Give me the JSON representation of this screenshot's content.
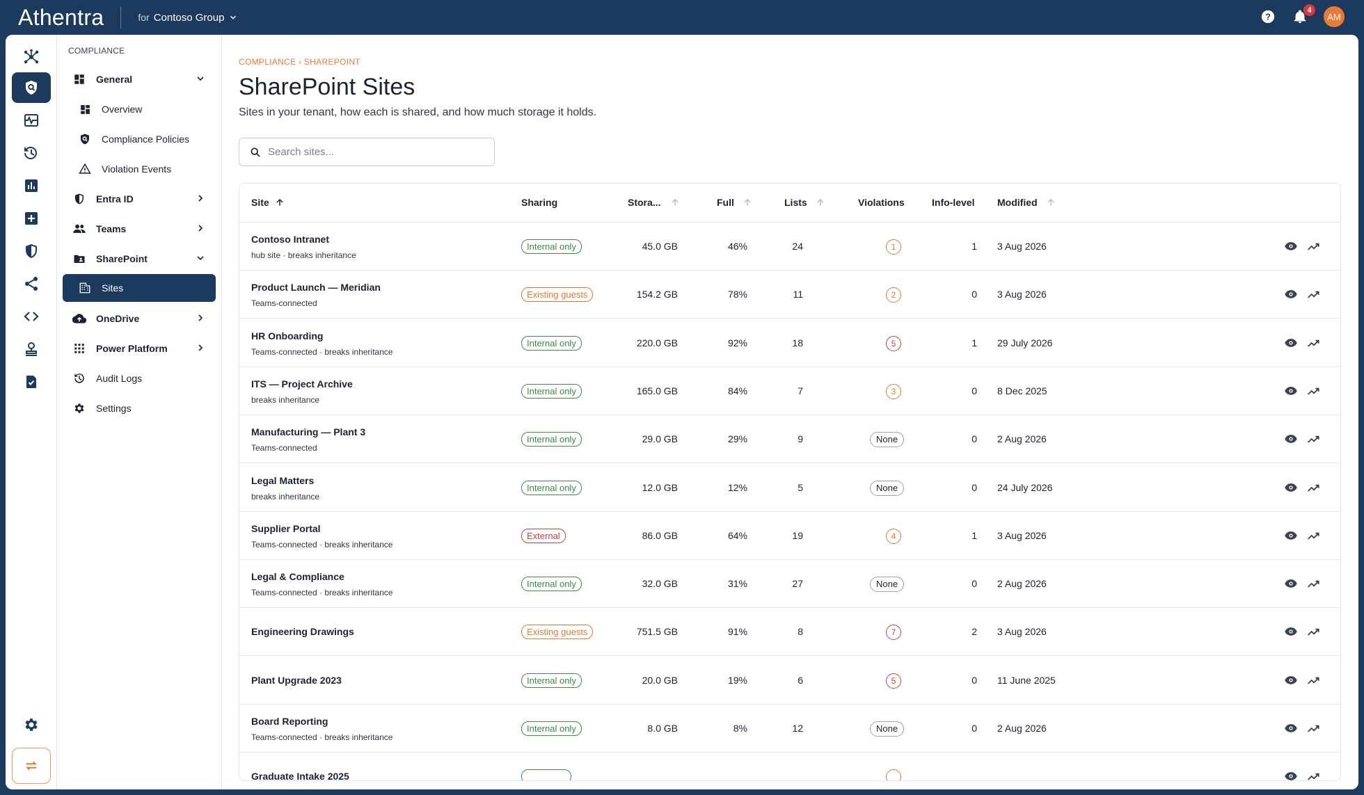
{
  "topbar": {
    "logo": "Athentra",
    "tenant_prefix": "for",
    "tenant_name": "Contoso Group",
    "notifications_count": "4",
    "avatar_initials": "AM"
  },
  "nav": {
    "section": "COMPLIANCE",
    "general": "General",
    "overview": "Overview",
    "compliance_policies": "Compliance Policies",
    "violation_events": "Violation Events",
    "entra_id": "Entra ID",
    "teams": "Teams",
    "sharepoint": "SharePoint",
    "sites": "Sites",
    "onedrive": "OneDrive",
    "power_platform": "Power Platform",
    "audit_logs": "Audit Logs",
    "settings": "Settings"
  },
  "page": {
    "breadcrumb": "COMPLIANCE › SHAREPOINT",
    "title": "SharePoint Sites",
    "subtitle": "Sites in your tenant, how each is shared, and how much storage it holds.",
    "search_placeholder": "Search sites..."
  },
  "table": {
    "headers": {
      "site": "Site",
      "sharing": "Sharing",
      "storage": "Stora...",
      "full": "Full",
      "lists": "Lists",
      "violations": "Violations",
      "info_level": "Info-level",
      "modified": "Modified"
    },
    "rows": [
      {
        "name": "Contoso Intranet",
        "meta": "hub site · breaks inheritance",
        "sharing": "Internal only",
        "sharing_type": "internal",
        "storage": "45.0 GB",
        "full": "46%",
        "lists": "24",
        "violations": "1",
        "viol_type": "warn",
        "info": "1",
        "modified": "3 Aug 2026"
      },
      {
        "name": "Product Launch — Meridian",
        "meta": "Teams-connected",
        "sharing": "Existing guests",
        "sharing_type": "guests",
        "storage": "154.2 GB",
        "full": "78%",
        "lists": "11",
        "violations": "2",
        "viol_type": "warn",
        "info": "0",
        "modified": "3 Aug 2026"
      },
      {
        "name": "HR Onboarding",
        "meta": "Teams-connected · breaks inheritance",
        "sharing": "Internal only",
        "sharing_type": "internal",
        "storage": "220.0 GB",
        "full": "92%",
        "lists": "18",
        "violations": "5",
        "viol_type": "crit",
        "info": "1",
        "modified": "29 July 2026"
      },
      {
        "name": "ITS — Project Archive",
        "meta": "breaks inheritance",
        "sharing": "Internal only",
        "sharing_type": "internal",
        "storage": "165.0 GB",
        "full": "84%",
        "lists": "7",
        "violations": "3",
        "viol_type": "warn",
        "info": "0",
        "modified": "8 Dec 2025"
      },
      {
        "name": "Manufacturing — Plant 3",
        "meta": "Teams-connected",
        "sharing": "Internal only",
        "sharing_type": "internal",
        "storage": "29.0 GB",
        "full": "29%",
        "lists": "9",
        "violations": "None",
        "viol_type": "none",
        "info": "0",
        "modified": "2 Aug 2026"
      },
      {
        "name": "Legal Matters",
        "meta": "breaks inheritance",
        "sharing": "Internal only",
        "sharing_type": "internal",
        "storage": "12.0 GB",
        "full": "12%",
        "lists": "5",
        "violations": "None",
        "viol_type": "none",
        "info": "0",
        "modified": "24 July 2026"
      },
      {
        "name": "Supplier Portal",
        "meta": "Teams-connected · breaks inheritance",
        "sharing": "External",
        "sharing_type": "external",
        "storage": "86.0 GB",
        "full": "64%",
        "lists": "19",
        "violations": "4",
        "viol_type": "warn",
        "info": "1",
        "modified": "3 Aug 2026"
      },
      {
        "name": "Legal & Compliance",
        "meta": "Teams-connected · breaks inheritance",
        "sharing": "Internal only",
        "sharing_type": "internal",
        "storage": "32.0 GB",
        "full": "31%",
        "lists": "27",
        "violations": "None",
        "viol_type": "none",
        "info": "0",
        "modified": "2 Aug 2026"
      },
      {
        "name": "Engineering Drawings",
        "meta": "",
        "sharing": "Existing guests",
        "sharing_type": "guests",
        "storage": "751.5 GB",
        "full": "91%",
        "lists": "8",
        "violations": "7",
        "viol_type": "crit",
        "info": "2",
        "modified": "3 Aug 2026"
      },
      {
        "name": "Plant Upgrade 2023",
        "meta": "",
        "sharing": "Internal only",
        "sharing_type": "internal",
        "storage": "20.0 GB",
        "full": "19%",
        "lists": "6",
        "violations": "5",
        "viol_type": "crit",
        "info": "0",
        "modified": "11 June 2025"
      },
      {
        "name": "Board Reporting",
        "meta": "Teams-connected · breaks inheritance",
        "sharing": "Internal only",
        "sharing_type": "internal",
        "storage": "8.0 GB",
        "full": "8%",
        "lists": "12",
        "violations": "None",
        "viol_type": "none",
        "info": "0",
        "modified": "2 Aug 2026"
      },
      {
        "name": "Graduate Intake 2025",
        "meta": "",
        "sharing": "",
        "sharing_type": "internal",
        "storage": "",
        "full": "",
        "lists": "",
        "violations": "",
        "viol_type": "warn",
        "info": "",
        "modified": ""
      }
    ]
  }
}
